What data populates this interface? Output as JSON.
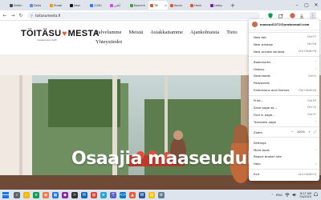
{
  "browser": {
    "tabs": [
      {
        "label": "Settin",
        "color": "#4a4a4a"
      },
      {
        "label": "Dello",
        "color": "#5b8def"
      },
      {
        "label": "Enabl",
        "color": "#f29900"
      },
      {
        "label": "New",
        "color": "#111111"
      },
      {
        "label": "(100)",
        "color": "#2979ff"
      },
      {
        "label": "آنلاین",
        "color": "#e040fb"
      },
      {
        "label": "Kasvinh",
        "color": "#43a047"
      },
      {
        "label": "Töi",
        "color": "#e05a29",
        "active": true
      },
      {
        "label": "Avoin",
        "color": "#e05a29"
      },
      {
        "label": "Henk",
        "color": "#e05a29"
      },
      {
        "label": "Ledig",
        "color": "#7b1fa2"
      }
    ],
    "url": "toitasumesta.fi",
    "window_controls": {
      "minimize": "–",
      "maximize": "▢",
      "close": "✕"
    }
  },
  "site": {
    "logo_left": "TÖITÄSU",
    "logo_right": "MESTA",
    "logo_tagline": "maaseudun työt",
    "nav": [
      "Palvelumme",
      "Meistä",
      "Asiakkaitamme",
      "Ajankohtaista",
      "Tieto"
    ],
    "nav_second_row": "Yhteystiedot",
    "hero_title": "Osaajia maaseudulle"
  },
  "menu": {
    "email": "masoud1372@protonmail.com",
    "groups": [
      [
        {
          "label": "New tab",
          "shortcut": "Ctrl+T"
        },
        {
          "label": "New window",
          "shortcut": "Ctrl+N"
        },
        {
          "label": "New private window",
          "shortcut": "Ctrl+Shift+N"
        }
      ],
      [
        {
          "label": "Bookmarks",
          "arrow": "›"
        },
        {
          "label": "History",
          "arrow": "›"
        },
        {
          "label": "Downloads",
          "shortcut": "Ctrl+J"
        },
        {
          "label": "Passwords",
          "shortcut": ""
        },
        {
          "label": "Extensions and themes",
          "shortcut": "Ctrl+Shift+A"
        }
      ],
      [
        {
          "label": "Print...",
          "shortcut": "Ctrl+P"
        },
        {
          "label": "Save page as...",
          "shortcut": "Ctrl+S"
        },
        {
          "label": "Find in page...",
          "shortcut": "Ctrl+F"
        },
        {
          "label": "Translate page",
          "arrow": "›"
        }
      ]
    ],
    "zoom": {
      "label": "Zoom",
      "minus": "−",
      "value": "100%",
      "plus": "+",
      "fullscreen": "⤢"
    },
    "groups2": [
      [
        {
          "label": "Settings",
          "shortcut": ""
        },
        {
          "label": "More tools",
          "arrow": "›"
        },
        {
          "label": "Report broken site",
          "shortcut": ""
        },
        {
          "label": "Help",
          "arrow": "›"
        }
      ],
      [
        {
          "label": "Exit",
          "shortcut": "Ctrl+Shift+Q"
        }
      ]
    ]
  },
  "taskbar": {
    "icons": [
      {
        "name": "search-icon",
        "color": "#5f6368",
        "glyph": "⌕"
      },
      {
        "name": "file-explorer-icon",
        "color": "#f4b400",
        "glyph": "▭"
      },
      {
        "name": "edge-icon",
        "color": "#0f9d58",
        "glyph": "e"
      },
      {
        "name": "firefox-icon",
        "color": "#ff7139",
        "glyph": "◉"
      },
      {
        "name": "store-icon",
        "color": "#1a73e8",
        "glyph": "▦"
      },
      {
        "name": "photos-icon",
        "color": "#8e24aa",
        "glyph": "◆"
      },
      {
        "name": "terminal-icon",
        "color": "#333333",
        "glyph": ">"
      },
      {
        "name": "mail-icon",
        "color": "#1565c0",
        "glyph": "✉"
      },
      {
        "name": "chrome-icon",
        "color": "#db4437",
        "glyph": "◍"
      },
      {
        "name": "telegram-icon",
        "color": "#2aa3d8",
        "glyph": "➤"
      },
      {
        "name": "teams-icon",
        "color": "#5b5fc7",
        "glyph": "T"
      },
      {
        "name": "code-icon",
        "color": "#007acc",
        "glyph": "<>"
      },
      {
        "name": "brave-icon",
        "color": "#fb542b",
        "glyph": "▲"
      },
      {
        "name": "word-icon",
        "color": "#2b579a",
        "glyph": "W"
      },
      {
        "name": "notes-icon",
        "color": "#fbbc04",
        "glyph": "▤"
      },
      {
        "name": "settings-icon",
        "color": "#607d8b",
        "glyph": "⚙"
      }
    ],
    "tray": {
      "lang": "ENG",
      "time": "8:27 AM",
      "date": "7/4/2025"
    }
  }
}
